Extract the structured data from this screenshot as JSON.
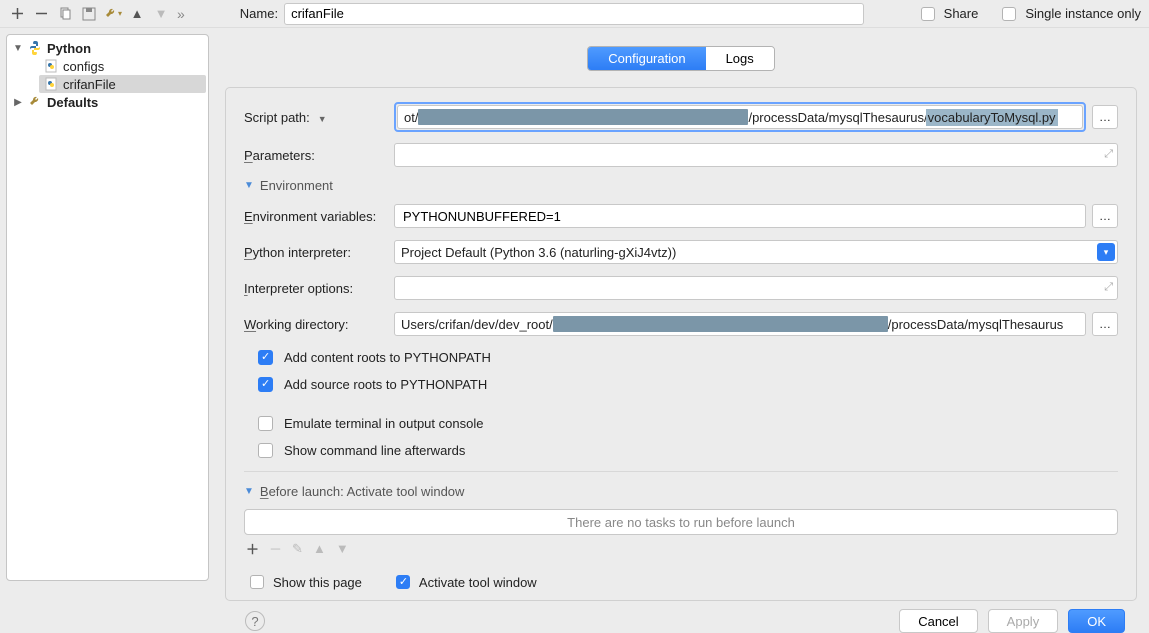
{
  "toolbar": {
    "name_label": "Name:",
    "name_value": "crifanFile",
    "share_label": "Share",
    "single_instance_label": "Single instance only"
  },
  "tree": {
    "root_python": "Python",
    "child_configs": "configs",
    "child_crifanfile": "crifanFile",
    "root_defaults": "Defaults"
  },
  "tabs": {
    "configuration": "Configuration",
    "logs": "Logs"
  },
  "form": {
    "script_path_label": "Script path:",
    "script_path_prefix": "ot/",
    "script_path_mid": "/processData/mysqlThesaurus/",
    "script_path_selected": "vocabularyToMysql.py",
    "parameters_label": "Parameters:",
    "parameters_value": "",
    "env_header": "Environment",
    "env_vars_label": "Environment variables:",
    "env_vars_value": "PYTHONUNBUFFERED=1",
    "python_interpreter_label": "Python interpreter:",
    "python_interpreter_value": "Project Default (Python 3.6 (naturling-gXiJ4vtz))",
    "interpreter_options_label": "Interpreter options:",
    "interpreter_options_value": "",
    "working_dir_label": "Working directory:",
    "working_dir_prefix": "Users/crifan/dev/dev_root/",
    "working_dir_suffix": "/processData/mysqlThesaurus",
    "chk_content_roots": "Add content roots to PYTHONPATH",
    "chk_source_roots": "Add source roots to PYTHONPATH",
    "chk_emulate_terminal": "Emulate terminal in output console",
    "chk_show_cmdline": "Show command line afterwards"
  },
  "before_launch": {
    "header": "Before launch: Activate tool window",
    "empty": "There are no tasks to run before launch",
    "show_this_page": "Show this page",
    "activate_tool_window": "Activate tool window"
  },
  "footer": {
    "cancel": "Cancel",
    "apply": "Apply",
    "ok": "OK"
  }
}
